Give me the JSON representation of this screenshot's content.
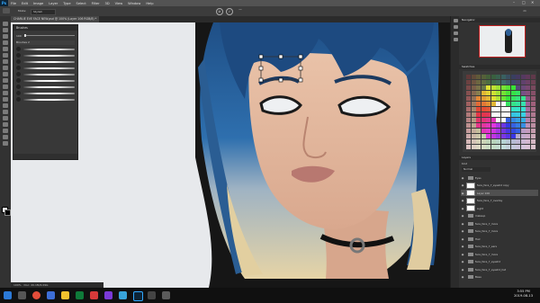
{
  "menubar": {
    "app_icon": "Ps",
    "items": [
      "File",
      "Edit",
      "Image",
      "Layer",
      "Type",
      "Select",
      "Filter",
      "3D",
      "View",
      "Window",
      "Help"
    ]
  },
  "optbar": {
    "mode_label": "Mode:",
    "mode_value": "Stylish"
  },
  "document": {
    "tab_title": "CHARLIE EVE FACE NEW.psd @ 100% (Layer 106 RGB/8) *"
  },
  "brushes_panel": {
    "title": "Brushes",
    "size_value": "100",
    "group_label": "Brushes 2",
    "stroke_count": 9
  },
  "navigator": {
    "title": "Navigator"
  },
  "swatches": {
    "title": "Swatches"
  },
  "layers": {
    "title": "Layers",
    "kind_label": "Kind",
    "blend_mode": "Normal",
    "rows": [
      {
        "name": "Eyes",
        "type": "folder"
      },
      {
        "name": "face_face_7_eyeshd copy",
        "type": "layer"
      },
      {
        "name": "Layer 106",
        "type": "layer",
        "selected": true
      },
      {
        "name": "face_face_7_overlay",
        "type": "layer"
      },
      {
        "name": "Light",
        "type": "layer"
      },
      {
        "name": "makeup",
        "type": "folder"
      },
      {
        "name": "face_face_7_more",
        "type": "folder"
      },
      {
        "name": "face_face_7_more",
        "type": "folder"
      },
      {
        "name": "Hair",
        "type": "folder"
      },
      {
        "name": "face_face_7_ears",
        "type": "folder"
      },
      {
        "name": "face_face_7_more",
        "type": "folder"
      },
      {
        "name": "face_face_7_eyeshd",
        "type": "folder"
      },
      {
        "name": "face_face_7_eyeshd_hat",
        "type": "folder"
      },
      {
        "name": "Base",
        "type": "folder"
      }
    ]
  },
  "status": {
    "zoom": "100%",
    "doc": "Doc: 20.1M/4.09G"
  },
  "taskbar": {
    "time": "3:55 PM",
    "date": "2019-08-13"
  }
}
